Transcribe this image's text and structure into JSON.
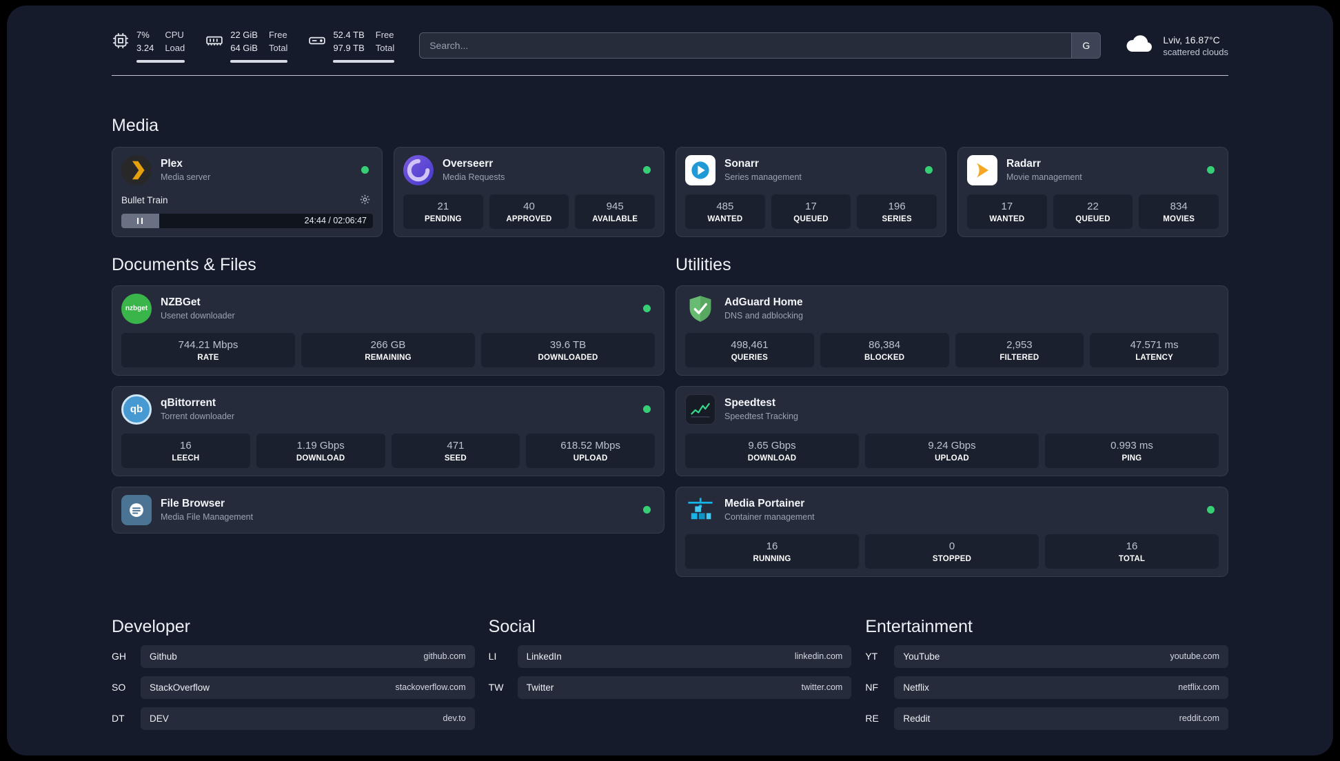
{
  "topbar": {
    "cpu": {
      "value1": "7%",
      "value2": "3.24",
      "label1": "CPU",
      "label2": "Load"
    },
    "ram": {
      "value1": "22 GiB",
      "value2": "64 GiB",
      "label1": "Free",
      "label2": "Total"
    },
    "disk": {
      "value1": "52.4 TB",
      "value2": "97.9 TB",
      "label1": "Free",
      "label2": "Total"
    },
    "search": {
      "placeholder": "Search...",
      "button_label": "G"
    },
    "weather": {
      "location": "Lviv, 16.87°C",
      "condition": "scattered clouds"
    }
  },
  "media": {
    "title": "Media",
    "plex": {
      "name": "Plex",
      "subtitle": "Media server",
      "now_playing": "Bullet Train",
      "time": "24:44 / 02:06:47"
    },
    "overseerr": {
      "name": "Overseerr",
      "subtitle": "Media Requests",
      "stats": [
        {
          "value": "21",
          "label": "PENDING"
        },
        {
          "value": "40",
          "label": "APPROVED"
        },
        {
          "value": "945",
          "label": "AVAILABLE"
        }
      ]
    },
    "sonarr": {
      "name": "Sonarr",
      "subtitle": "Series management",
      "stats": [
        {
          "value": "485",
          "label": "WANTED"
        },
        {
          "value": "17",
          "label": "QUEUED"
        },
        {
          "value": "196",
          "label": "SERIES"
        }
      ]
    },
    "radarr": {
      "name": "Radarr",
      "subtitle": "Movie management",
      "stats": [
        {
          "value": "17",
          "label": "WANTED"
        },
        {
          "value": "22",
          "label": "QUEUED"
        },
        {
          "value": "834",
          "label": "MOVIES"
        }
      ]
    }
  },
  "documents": {
    "title": "Documents & Files",
    "nzbget": {
      "name": "NZBGet",
      "subtitle": "Usenet downloader",
      "icon_text": "nzbget",
      "stats": [
        {
          "value": "744.21 Mbps",
          "label": "RATE"
        },
        {
          "value": "266 GB",
          "label": "REMAINING"
        },
        {
          "value": "39.6 TB",
          "label": "DOWNLOADED"
        }
      ]
    },
    "qbittorrent": {
      "name": "qBittorrent",
      "subtitle": "Torrent downloader",
      "icon_text": "qb",
      "stats": [
        {
          "value": "16",
          "label": "LEECH"
        },
        {
          "value": "1.19 Gbps",
          "label": "DOWNLOAD"
        },
        {
          "value": "471",
          "label": "SEED"
        },
        {
          "value": "618.52 Mbps",
          "label": "UPLOAD"
        }
      ]
    },
    "filebrowser": {
      "name": "File Browser",
      "subtitle": "Media File Management"
    }
  },
  "utilities": {
    "title": "Utilities",
    "adguard": {
      "name": "AdGuard Home",
      "subtitle": "DNS and adblocking",
      "stats": [
        {
          "value": "498,461",
          "label": "QUERIES"
        },
        {
          "value": "86,384",
          "label": "BLOCKED"
        },
        {
          "value": "2,953",
          "label": "FILTERED"
        },
        {
          "value": "47.571 ms",
          "label": "LATENCY"
        }
      ]
    },
    "speedtest": {
      "name": "Speedtest",
      "subtitle": "Speedtest Tracking",
      "stats": [
        {
          "value": "9.65 Gbps",
          "label": "DOWNLOAD"
        },
        {
          "value": "9.24 Gbps",
          "label": "UPLOAD"
        },
        {
          "value": "0.993 ms",
          "label": "PING"
        }
      ]
    },
    "portainer": {
      "name": "Media Portainer",
      "subtitle": "Container management",
      "stats": [
        {
          "value": "16",
          "label": "RUNNING"
        },
        {
          "value": "0",
          "label": "STOPPED"
        },
        {
          "value": "16",
          "label": "TOTAL"
        }
      ]
    }
  },
  "bookmarks": {
    "developer": {
      "title": "Developer",
      "items": [
        {
          "abbr": "GH",
          "name": "Github",
          "url": "github.com"
        },
        {
          "abbr": "SO",
          "name": "StackOverflow",
          "url": "stackoverflow.com"
        },
        {
          "abbr": "DT",
          "name": "DEV",
          "url": "dev.to"
        }
      ]
    },
    "social": {
      "title": "Social",
      "items": [
        {
          "abbr": "LI",
          "name": "LinkedIn",
          "url": "linkedin.com"
        },
        {
          "abbr": "TW",
          "name": "Twitter",
          "url": "twitter.com"
        }
      ]
    },
    "entertainment": {
      "title": "Entertainment",
      "items": [
        {
          "abbr": "YT",
          "name": "YouTube",
          "url": "youtube.com"
        },
        {
          "abbr": "NF",
          "name": "Netflix",
          "url": "netflix.com"
        },
        {
          "abbr": "RE",
          "name": "Reddit",
          "url": "reddit.com"
        }
      ]
    }
  }
}
